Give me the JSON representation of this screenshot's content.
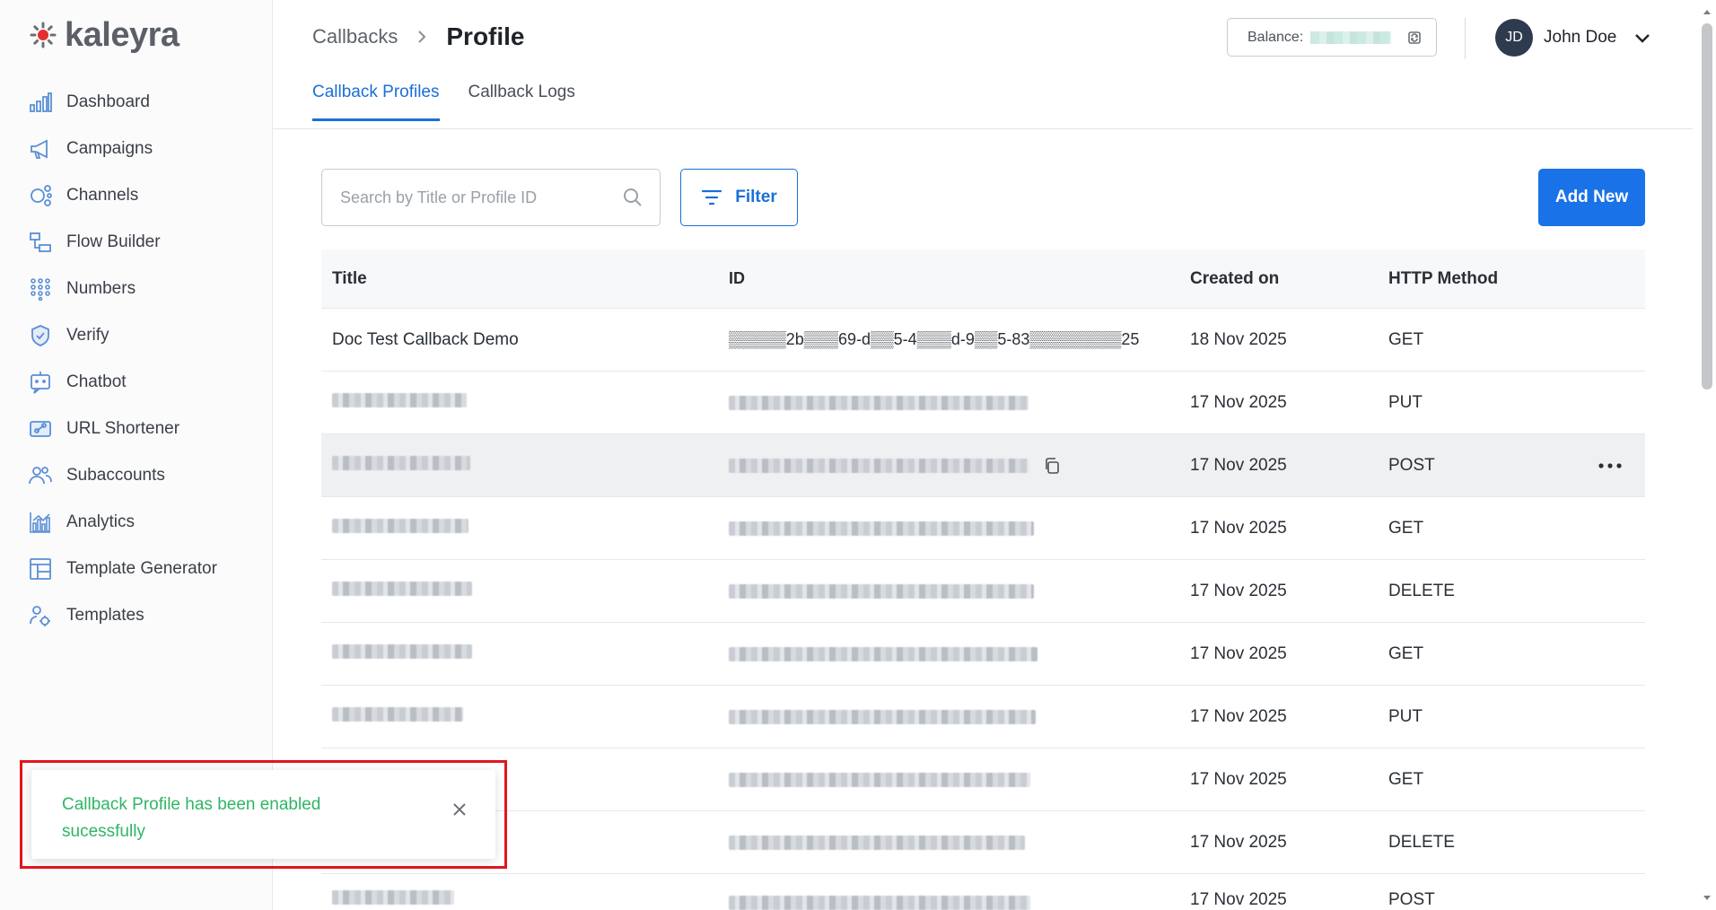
{
  "app": {
    "brand": "kaleyra"
  },
  "sidebar": {
    "items": [
      {
        "label": "Dashboard",
        "icon": "dashboard-icon"
      },
      {
        "label": "Campaigns",
        "icon": "megaphone-icon"
      },
      {
        "label": "Channels",
        "icon": "channels-icon"
      },
      {
        "label": "Flow Builder",
        "icon": "flow-builder-icon"
      },
      {
        "label": "Numbers",
        "icon": "dialpad-icon"
      },
      {
        "label": "Verify",
        "icon": "shield-check-icon"
      },
      {
        "label": "Chatbot",
        "icon": "chatbot-icon"
      },
      {
        "label": "URL Shortener",
        "icon": "link-icon"
      },
      {
        "label": "Subaccounts",
        "icon": "users-icon"
      },
      {
        "label": "Analytics",
        "icon": "analytics-icon"
      },
      {
        "label": "Template Generator",
        "icon": "template-generator-icon"
      },
      {
        "label": "Templates",
        "icon": "templates-icon"
      }
    ]
  },
  "header": {
    "breadcrumb_parent": "Callbacks",
    "breadcrumb_current": "Profile",
    "tabs": [
      {
        "label": "Callback Profiles",
        "active": true
      },
      {
        "label": "Callback Logs",
        "active": false
      }
    ],
    "balance_label": "Balance:",
    "user_initials": "JD",
    "user_name": "John Doe"
  },
  "toolbar": {
    "search_placeholder": "Search by Title or Profile ID",
    "filter_label": "Filter",
    "add_label": "Add New"
  },
  "table": {
    "columns": [
      "Title",
      "ID",
      "Created on",
      "HTTP Method"
    ],
    "rows": [
      {
        "title": "Doc Test Callback Demo",
        "id": "▒▒▒▒▒2b▒▒▒69-d▒▒5-4▒▒▒d-9▒▒5-83▒▒▒▒▒▒▒▒25",
        "created_on": "18 Nov 2025",
        "method": "GET"
      },
      {
        "title": "",
        "id": "",
        "created_on": "17 Nov 2025",
        "method": "PUT"
      },
      {
        "title": "",
        "id": "",
        "created_on": "17 Nov 2025",
        "method": "POST"
      },
      {
        "title": "",
        "id": "",
        "created_on": "17 Nov 2025",
        "method": "GET"
      },
      {
        "title": "",
        "id": "",
        "created_on": "17 Nov 2025",
        "method": "DELETE"
      },
      {
        "title": "",
        "id": "",
        "created_on": "17 Nov 2025",
        "method": "GET"
      },
      {
        "title": "",
        "id": "",
        "created_on": "17 Nov 2025",
        "method": "PUT"
      },
      {
        "title": "",
        "id": "",
        "created_on": "17 Nov 2025",
        "method": "GET"
      },
      {
        "title": "",
        "id": "",
        "created_on": "17 Nov 2025",
        "method": "DELETE"
      },
      {
        "title": "",
        "id": "",
        "created_on": "17 Nov 2025",
        "method": "POST"
      }
    ]
  },
  "toast": {
    "message": "Callback Profile has been enabled sucessfully"
  },
  "colors": {
    "accent": "#1a6fd6",
    "success_text": "#2fb565",
    "highlight_border": "#e0161b"
  }
}
